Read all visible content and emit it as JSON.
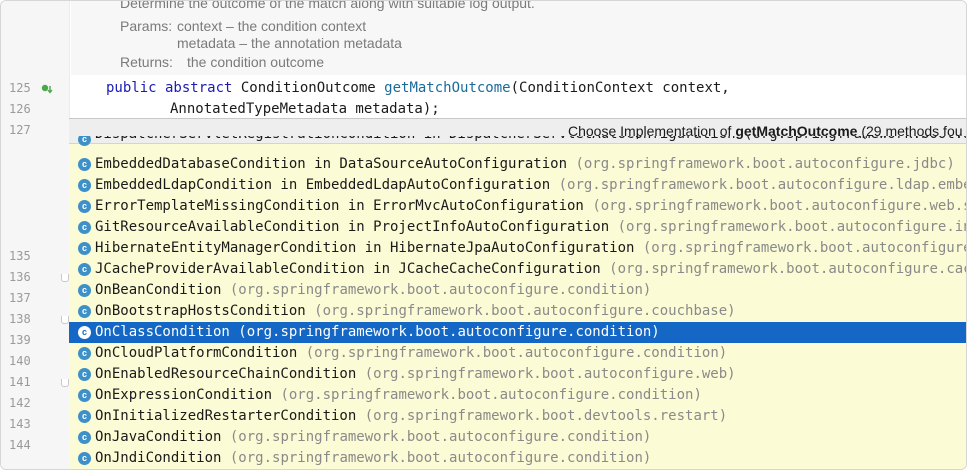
{
  "doc": {
    "summary": "Determine the outcome of the match along with suitable log output.",
    "params_label": "Params:",
    "param1": "context – the condition context",
    "param2": "metadata – the annotation metadata",
    "returns_label": "Returns:",
    "returns_text": "the condition outcome"
  },
  "code": {
    "line125_kw": "public abstract ",
    "line125_type": "ConditionOutcome ",
    "line125_method": "getMatchOutcome",
    "line125_rest": "(ConditionContext context,",
    "line126": "AnnotatedTypeMetadata metadata);"
  },
  "line_numbers": {
    "l125": "125",
    "l126": "126",
    "l127": "127",
    "l135": "135",
    "l136": "136",
    "l137": "137",
    "l138": "138",
    "l139": "139",
    "l140": "140",
    "l141": "141",
    "l142": "142",
    "l143": "143",
    "l144": "144"
  },
  "popup": {
    "title_prefix": "Choose Implementation of ",
    "title_method": "getMatchOutcome",
    "title_suffix": " (29 methods fou",
    "partial_row": "DispatcherServletRegistrationCondition in DispatcherServletAutoConfiguration (org.springframework.boot.autoconfi",
    "items": [
      {
        "name": "EmbeddedDatabaseCondition in DataSourceAutoConfiguration",
        "pkg": "(org.springframework.boot.autoconfigure.jdbc)"
      },
      {
        "name": "EmbeddedLdapCondition in EmbeddedLdapAutoConfiguration",
        "pkg": "(org.springframework.boot.autoconfigure.ldap.embedded)"
      },
      {
        "name": "ErrorTemplateMissingCondition in ErrorMvcAutoConfiguration",
        "pkg": "(org.springframework.boot.autoconfigure.web.servlet.e"
      },
      {
        "name": "GitResourceAvailableCondition in ProjectInfoAutoConfiguration",
        "pkg": "(org.springframework.boot.autoconfigure.info)"
      },
      {
        "name": "HibernateEntityManagerCondition in HibernateJpaAutoConfiguration",
        "pkg": "(org.springframework.boot.autoconfigure.orm.jpa"
      },
      {
        "name": "JCacheProviderAvailableCondition in JCacheCacheConfiguration",
        "pkg": "(org.springframework.boot.autoconfigure.cache)"
      },
      {
        "name": "OnBeanCondition",
        "pkg": "(org.springframework.boot.autoconfigure.condition)"
      },
      {
        "name": "OnBootstrapHostsCondition",
        "pkg": "(org.springframework.boot.autoconfigure.couchbase)"
      },
      {
        "name": "OnClassCondition",
        "pkg": "(org.springframework.boot.autoconfigure.condition)"
      },
      {
        "name": "OnCloudPlatformCondition",
        "pkg": "(org.springframework.boot.autoconfigure.condition)"
      },
      {
        "name": "OnEnabledResourceChainCondition",
        "pkg": "(org.springframework.boot.autoconfigure.web)"
      },
      {
        "name": "OnExpressionCondition",
        "pkg": "(org.springframework.boot.autoconfigure.condition)"
      },
      {
        "name": "OnInitializedRestarterCondition",
        "pkg": "(org.springframework.boot.devtools.restart)"
      },
      {
        "name": "OnJavaCondition",
        "pkg": "(org.springframework.boot.autoconfigure.condition)"
      },
      {
        "name": "OnJndiCondition",
        "pkg": "(org.springframework.boot.autoconfigure.condition)"
      }
    ],
    "class_icon_letter": "c"
  },
  "colors": {
    "selection": "#1467c4",
    "popup_bg": "#fbfbd6",
    "class_icon": "#3d91c8"
  }
}
